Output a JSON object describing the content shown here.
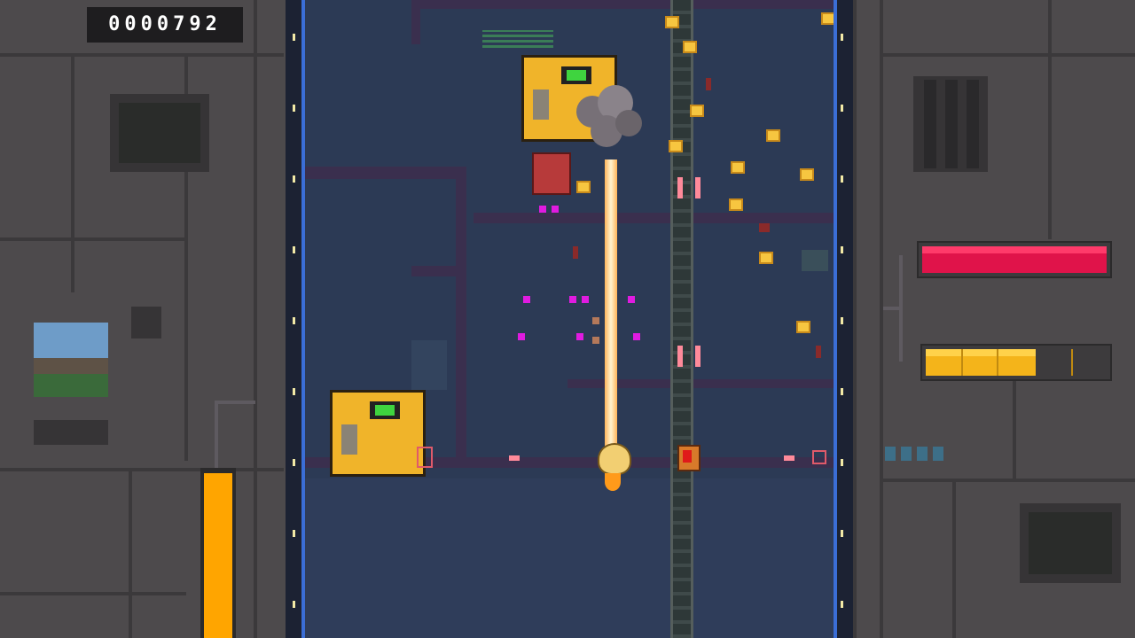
{
  "hud": {
    "score": "0000792"
  },
  "bars": {
    "health": {
      "color": "#e0134a",
      "fill": 1.0
    },
    "energy": {
      "color": "#f4b41a",
      "fill": 0.63
    },
    "power": {
      "color": "#ffa500",
      "fill": 1.0
    }
  },
  "colors": {
    "background": "#4a4749",
    "playfield": "#2c3a55",
    "rail_edge": "#3b6ed6",
    "enemy_body": "#f0b42a",
    "enemy_bullet": "#e01be0",
    "laser": "#fff3cf"
  }
}
